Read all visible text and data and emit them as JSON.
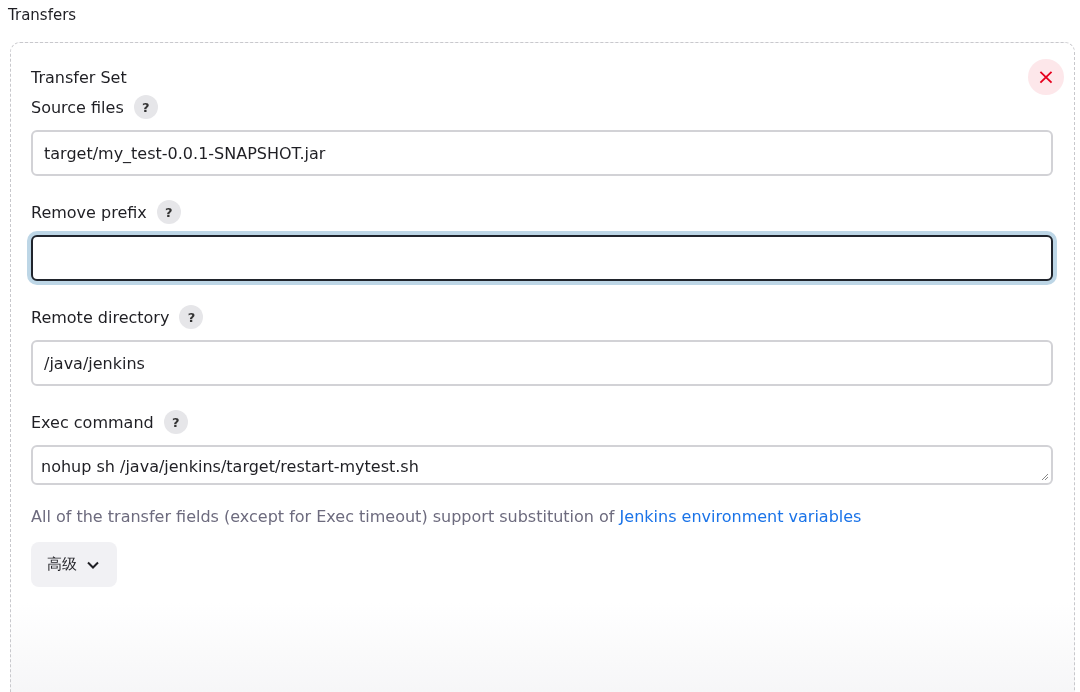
{
  "section_title": "Transfers",
  "transfer_set": {
    "title": "Transfer Set",
    "close_button": "×",
    "fields": [
      {
        "kind": "input",
        "label": "Source files",
        "help": "?",
        "value": "target/my_test-0.0.1-SNAPSHOT.jar",
        "focused": false
      },
      {
        "kind": "input",
        "label": "Remove prefix",
        "help": "?",
        "focused": true
      },
      {
        "kind": "input",
        "label": "Remote directory",
        "help": "?",
        "value": "/java/jenkins",
        "focused": false
      },
      {
        "kind": "textarea",
        "label": "Exec command",
        "help": "?",
        "value": "nohup sh /java/jenkins/target/restart-mytest.sh",
        "focused": false
      }
    ],
    "note": {
      "text": "All of the transfer fields (except for Exec timeout) support substitution of",
      "link": "Jenkins environment variables"
    },
    "advanced_button": "高级"
  }
}
